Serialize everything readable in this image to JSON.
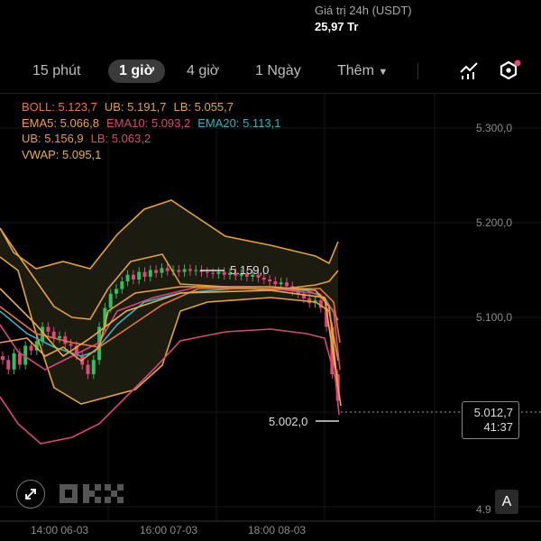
{
  "header": {
    "stat_label": "Giá trị 24h (USDT)",
    "stat_value": "25,97 Tr"
  },
  "tabs": [
    {
      "label": "15 phút"
    },
    {
      "label": "1 giờ",
      "active": true
    },
    {
      "label": "4 giờ"
    },
    {
      "label": "1 Ngày"
    },
    {
      "label": "Thêm"
    }
  ],
  "toolbar": {
    "indicator_icon": "chart-indicator-icon",
    "settings_icon": "hexagon-settings-icon",
    "notification_color": "#e8457a"
  },
  "legend": {
    "boll": "BOLL: 5.123,7",
    "boll_ub": "UB: 5.191,7",
    "boll_lb": "LB: 5.055,7",
    "ema5": "EMA5: 5.066,8",
    "ema10": "EMA10: 5.093,2",
    "ema20": "EMA20: 5.113,1",
    "env_ub": "UB: 5.156,9",
    "env_lb": "LB: 5.063,2",
    "vwap": "VWAP: 5.095,1"
  },
  "colors": {
    "up": "#2fbf5c",
    "down": "#e0457b",
    "boll": "#e3a23b",
    "ema5": "#f0a13a",
    "ema10": "#d9477c",
    "ema20": "#31b3c8",
    "vwap": "#e9b040"
  },
  "chart_data": {
    "type": "candlestick",
    "y_axis_ticks": [
      "5.300,0",
      "5.200,0",
      "5.100,0",
      "4.9"
    ],
    "y_tick_values": [
      5.3,
      5.2,
      5.1,
      4.9
    ],
    "x_axis_ticks": [
      "14:00 06-03",
      "16:00 07-03",
      "18:00 08-03"
    ],
    "ylim": [
      4.88,
      5.33
    ],
    "high_label": "5.159,0",
    "low_label": "5.002,0",
    "last_price": "5.012,7",
    "countdown": "41:37",
    "closes": [
      5.055,
      5.045,
      5.062,
      5.05,
      5.07,
      5.065,
      5.075,
      5.09,
      5.085,
      5.078,
      5.08,
      5.072,
      5.07,
      5.06,
      5.05,
      5.04,
      5.055,
      5.09,
      5.11,
      5.125,
      5.13,
      5.138,
      5.145,
      5.14,
      5.148,
      5.143,
      5.15,
      5.147,
      5.152,
      5.149,
      5.15,
      5.148,
      5.151,
      5.149,
      5.15,
      5.148,
      5.147,
      5.146,
      5.148,
      5.145,
      5.147,
      5.144,
      5.146,
      5.143,
      5.145,
      5.142,
      5.14,
      5.138,
      5.135,
      5.137,
      5.133,
      5.128,
      5.125,
      5.12,
      5.115,
      5.118,
      5.11,
      5.09,
      5.04,
      5.012
    ]
  },
  "watermark": "OKX",
  "auto_button": "A"
}
